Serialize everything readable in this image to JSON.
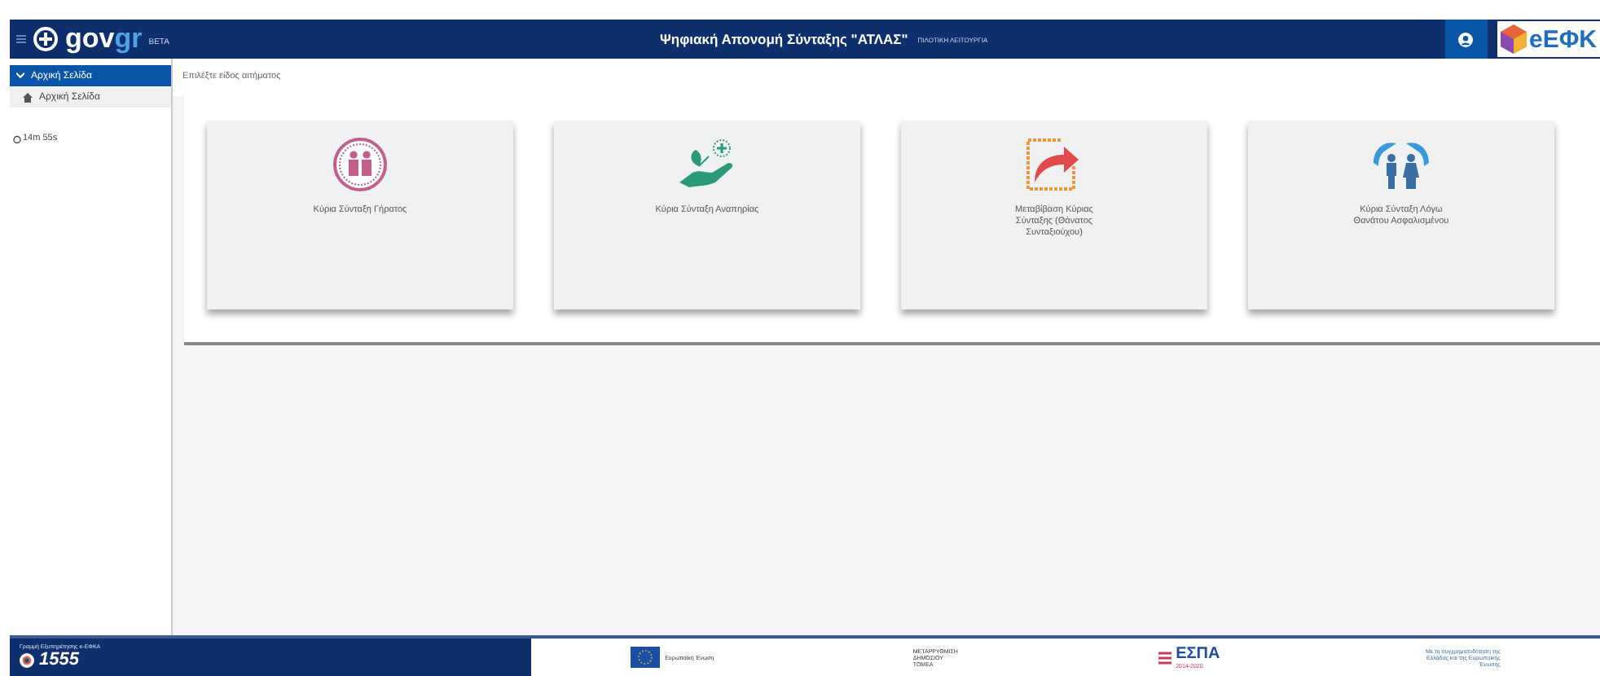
{
  "header": {
    "logo": "gov",
    "logo_accent": "gr",
    "beta": "BETA",
    "title": "Ψηφιακή Απονομή Σύνταξης \"ΑΤΛΑΣ\"",
    "subtitle": "ΠΙΛΟΤΙΚΗ ΛΕΙΤΟΥΡΓΙΑ",
    "brand": "eΕΦΚ"
  },
  "sidebar": {
    "items": [
      {
        "label": "Αρχική Σελίδα",
        "kind": "group",
        "expanded": true,
        "selected": true
      },
      {
        "label": "Αρχική Σελίδα",
        "kind": "link",
        "selected": false
      }
    ],
    "timer": "14m 55s"
  },
  "content": {
    "prompt": "Επιλέξτε είδος αιτήματος",
    "cards": [
      {
        "label": "Κύρια Σύνταξη Γήρατος",
        "kind": "elderly"
      },
      {
        "label": "Κύρια Σύνταξη Αναπηρίας",
        "kind": "disability"
      },
      {
        "label": "Μεταβίβαση Κύριας Σύνταξης (Θάνατος Συνταξιούχου)",
        "kind": "transfer"
      },
      {
        "label": "Κύρια Σύνταξη Λόγω Θανάτου Ασφαλισμένου",
        "kind": "survivor"
      }
    ]
  },
  "footer": {
    "helpline_label": "Γραμμή Εξυπηρέτησης e-ΕΦΚΑ",
    "helpline": "1555",
    "eu": "Ευρωπαϊκή Ένωση",
    "reform": "ΜΕΤΑΡΡΥΘΜΙΣΗ ΔΗΜΟΣΙΟΥ ΤΟΜΕΑ",
    "espa": "ΕΣΠΑ",
    "espa_years": "2014-2020",
    "cofunding": "Με τη συγχρηματοδότηση της Ελλάδας και της Ευρωπαϊκής Ένωσης"
  }
}
